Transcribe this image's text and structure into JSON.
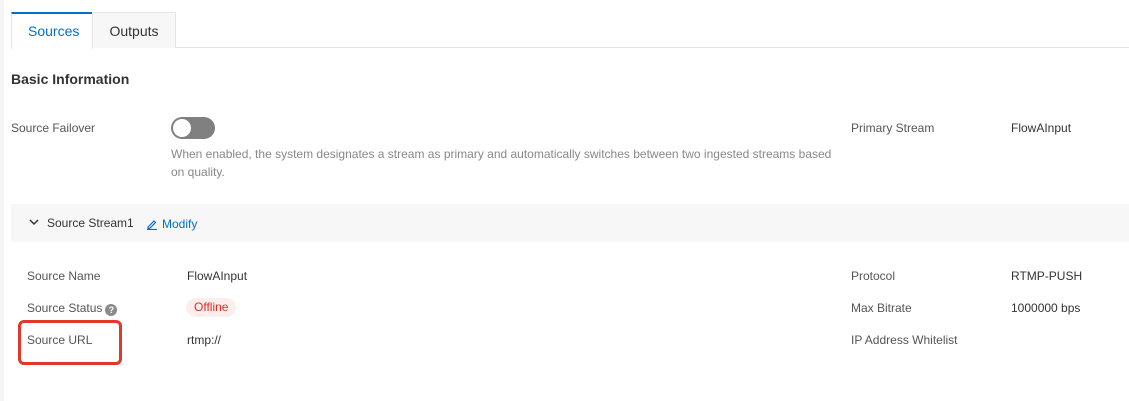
{
  "tabs": [
    {
      "label": "Sources",
      "active": true
    },
    {
      "label": "Outputs",
      "active": false
    }
  ],
  "basic_info": {
    "title": "Basic Information",
    "failover_label": "Source Failover",
    "failover_enabled": false,
    "failover_help": "When enabled, the system designates a stream as primary and automatically switches between two ingested streams based on quality.",
    "primary_stream_label": "Primary Stream",
    "primary_stream_value": "FlowAInput"
  },
  "stream": {
    "title": "Source Stream1",
    "modify_label": "Modify",
    "name_label": "Source Name",
    "name_value": "FlowAInput",
    "status_label": "Source Status",
    "status_value": "Offline",
    "url_label": "Source URL",
    "url_value": "rtmp://",
    "protocol_label": "Protocol",
    "protocol_value": "RTMP-PUSH",
    "bitrate_label": "Max Bitrate",
    "bitrate_value": "1000000 bps",
    "whitelist_label": "IP Address Whitelist",
    "whitelist_value": ""
  },
  "colors": {
    "accent": "#0070cc",
    "offline": "#d93026",
    "highlight": "#e0392b"
  },
  "icons": {
    "chevron": "chevron-down-icon",
    "edit": "pencil-icon",
    "help": "question-circle-icon"
  }
}
